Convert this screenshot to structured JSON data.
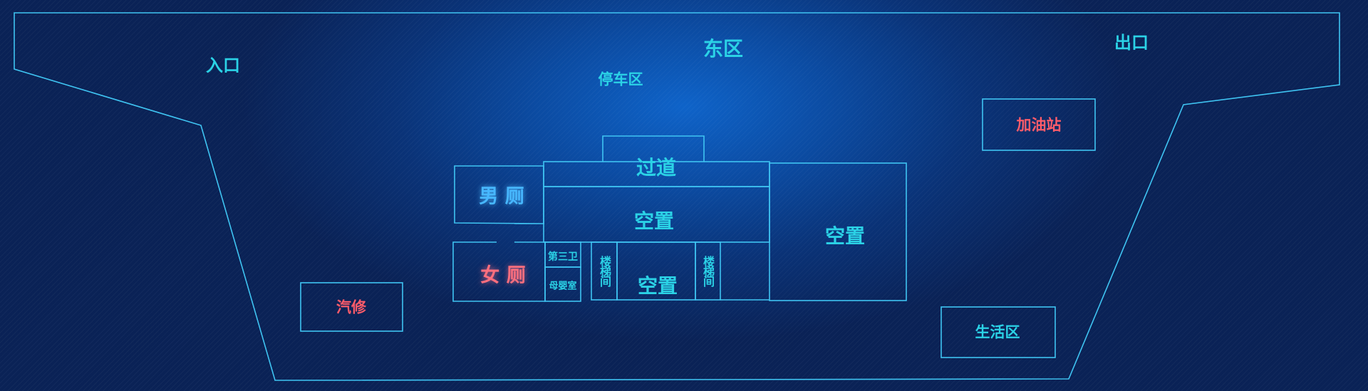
{
  "map": {
    "zones": {
      "entrance": "入口",
      "east_zone": "东区",
      "exit": "出口",
      "parking": "停车区",
      "gas_station": "加油站",
      "passage": "过道",
      "mens_restroom": "男 厕",
      "womens_restroom": "女 厕",
      "third_restroom": "第三卫",
      "nursing_room": "母婴室",
      "vacant_center": "空置",
      "vacant_right": "空置",
      "vacant_small": "空置",
      "stairwell_left": "楼梯间",
      "stairwell_right": "楼梯间",
      "car_repair": "汽修",
      "living_area": "生活区"
    },
    "colors": {
      "line": "#3fc4f2",
      "label_cyan": "#2bd2e6",
      "label_red": "#ff5c6a",
      "label_pink": "#ff6f7e",
      "restroom_blue": "#47b7ff",
      "background": "#0b3a86"
    }
  }
}
